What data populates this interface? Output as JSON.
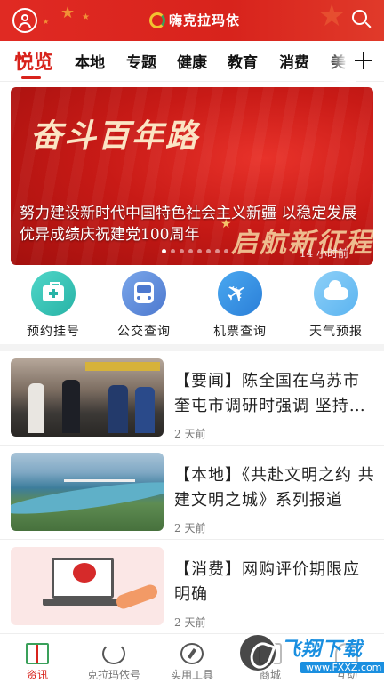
{
  "header": {
    "app_name": "嗨克拉玛依",
    "accent_color": "#d8231c",
    "profile_icon": "user-circle-icon",
    "search_icon": "search-icon"
  },
  "tabs": [
    {
      "label": "悦览",
      "active": true
    },
    {
      "label": "本地",
      "active": false
    },
    {
      "label": "专题",
      "active": false
    },
    {
      "label": "健康",
      "active": false
    },
    {
      "label": "教育",
      "active": false
    },
    {
      "label": "消费",
      "active": false
    },
    {
      "label": "美",
      "active": false
    }
  ],
  "add_tab_icon": "plus-icon",
  "banner": {
    "calligraphy": "奋斗百年路",
    "calligraphy2": "启航新征程",
    "title": "努力建设新时代中国特色社会主义新疆 以稳定发展优异成绩庆祝建党100周年",
    "time": "14 小时前",
    "slide_count": 8,
    "active_slide": 1
  },
  "services": [
    {
      "label": "预约挂号",
      "icon": "medical-kit-icon",
      "color": "#28b3a6"
    },
    {
      "label": "公交查询",
      "icon": "bus-icon",
      "color": "#4d79cf"
    },
    {
      "label": "机票查询",
      "icon": "airplane-icon",
      "color": "#2b7fd8"
    },
    {
      "label": "天气预报",
      "icon": "cloud-icon",
      "color": "#5bb4f0"
    }
  ],
  "news": [
    {
      "title": "【要闻】陈全国在乌苏市奎屯市调研时强调 坚持以人民为中心",
      "time": "2 天前"
    },
    {
      "title": "【本地】《共赴文明之约 共建文明之城》系列报道",
      "time": "2 天前"
    },
    {
      "title": "【消费】网购评价期限应明确",
      "time": "2 天前"
    }
  ],
  "bottom_nav": [
    {
      "label": "资讯",
      "icon": "book-icon",
      "active": true
    },
    {
      "label": "克拉玛依号",
      "icon": "refresh-icon",
      "active": false
    },
    {
      "label": "实用工具",
      "icon": "compass-icon",
      "active": false
    },
    {
      "label": "商城",
      "icon": "grid-icon",
      "active": false
    },
    {
      "label": "互动",
      "icon": "user-icon",
      "active": false
    }
  ],
  "watermark": {
    "text": "飞翔下载",
    "url": "www.FXXZ.com"
  }
}
